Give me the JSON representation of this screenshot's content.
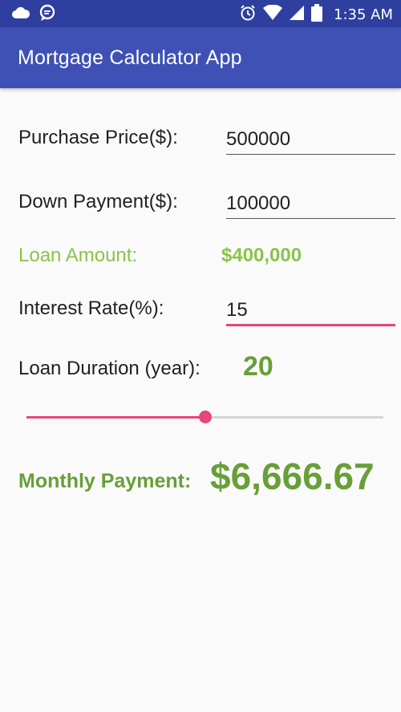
{
  "status_bar": {
    "time": "1:35 AM",
    "left_icons": [
      "cloud-icon",
      "message-icon"
    ],
    "right_icons": [
      "alarm-icon",
      "wifi-icon",
      "signal-icon",
      "battery-icon"
    ]
  },
  "app_bar": {
    "title": "Mortgage Calculator App"
  },
  "form": {
    "purchase_price_label": "Purchase Price($):",
    "purchase_price_value": "500000",
    "down_payment_label": "Down Payment($):",
    "down_payment_value": "100000",
    "loan_amount_label": "Loan Amount:",
    "loan_amount_value": "$400,000",
    "interest_rate_label": "Interest Rate(%):",
    "interest_rate_value": "15",
    "loan_duration_label": "Loan Duration (year):",
    "loan_duration_value": "20",
    "duration_slider_fraction": 0.5,
    "monthly_payment_label": "Monthly Payment:",
    "monthly_payment_value": "$6,666.67"
  },
  "colors": {
    "primary": "#3f51b5",
    "primary_dark": "#2f3f9f",
    "accent": "#e8447e",
    "loan_green": "#8bc34a",
    "result_green": "#689f38"
  }
}
